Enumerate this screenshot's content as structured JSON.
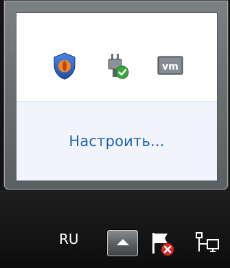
{
  "flyout": {
    "icons": [
      {
        "icon": "shield-icon"
      },
      {
        "icon": "power-plug-check-icon"
      },
      {
        "icon": "vmware-icon",
        "text": "vm"
      }
    ],
    "customize_label": "Настроить..."
  },
  "taskbar": {
    "language": "RU",
    "show_hidden_icon": "chevron-up-icon",
    "icons": [
      {
        "icon": "action-center-flag-error-icon"
      },
      {
        "icon": "network-icon"
      }
    ]
  },
  "colors": {
    "link": "#1f5fb3",
    "taskbar": "#141414",
    "flyout_frame": "#6a7072"
  }
}
